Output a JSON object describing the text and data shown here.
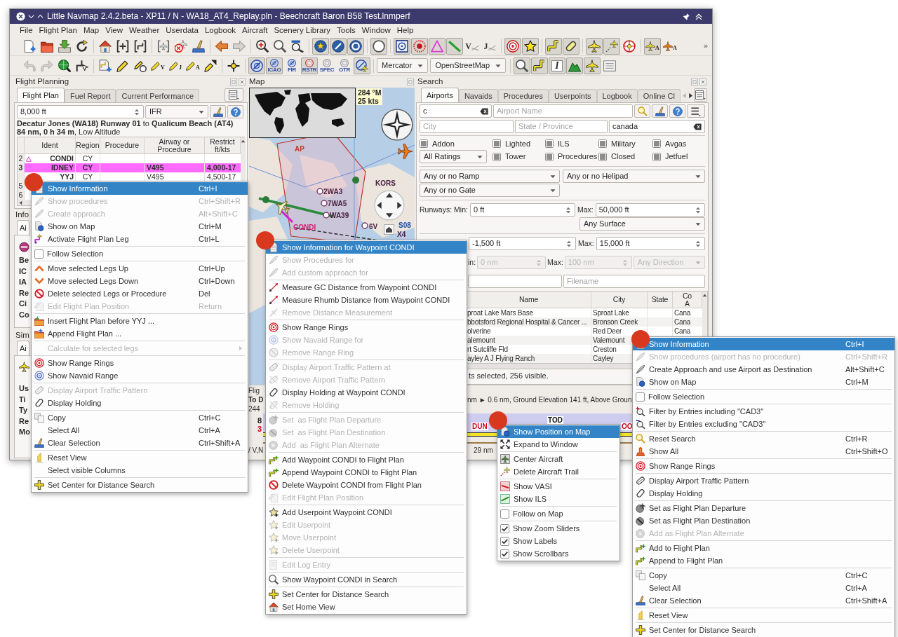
{
  "window": {
    "title": "Little Navmap 2.4.2.beta - XP11 / N - WA18_AT4_Replay.pln - Beechcraft Baron B58 Test.lnmperf"
  },
  "menu_bar": [
    "File",
    "Flight Plan",
    "Map",
    "View",
    "Weather",
    "Userdata",
    "Logbook",
    "Aircraft",
    "Scenery Library",
    "Tools",
    "Window",
    "Help"
  ],
  "toolbars": [
    [
      {
        "kind": "button",
        "pressed": false
      },
      {
        "kind": "button",
        "pressed": false
      },
      {
        "kind": "button",
        "pressed": false
      },
      {
        "kind": "button",
        "pressed": false
      },
      {
        "kind": "separator"
      },
      {
        "kind": "button",
        "pressed": false
      },
      {
        "kind": "button",
        "pressed": false
      },
      {
        "kind": "button",
        "pressed": false
      },
      {
        "kind": "separator"
      },
      {
        "kind": "button",
        "pressed": false
      },
      {
        "kind": "button",
        "pressed": false
      },
      {
        "kind": "button",
        "pressed": false
      },
      {
        "kind": "separator"
      },
      {
        "kind": "button",
        "pressed": false
      },
      {
        "kind": "button",
        "pressed": false
      },
      {
        "kind": "separator"
      },
      {
        "kind": "button",
        "pressed": false
      },
      {
        "kind": "button",
        "pressed": false
      },
      {
        "kind": "button",
        "pressed": false
      },
      {
        "kind": "separator"
      },
      {
        "kind": "button",
        "pressed": true
      },
      {
        "kind": "button",
        "pressed": true
      },
      {
        "kind": "button",
        "pressed": true
      },
      {
        "kind": "separator"
      },
      {
        "kind": "button",
        "pressed": true
      },
      {
        "kind": "separator"
      },
      {
        "kind": "button",
        "pressed": true
      },
      {
        "kind": "button",
        "pressed": true
      },
      {
        "kind": "button",
        "pressed": true
      },
      {
        "kind": "button",
        "pressed": true
      },
      {
        "kind": "button",
        "pressed": false,
        "label": "V"
      },
      {
        "kind": "button",
        "pressed": false,
        "label": "J"
      },
      {
        "kind": "separator"
      },
      {
        "kind": "button",
        "pressed": true
      },
      {
        "kind": "button",
        "pressed": true
      },
      {
        "kind": "separator"
      },
      {
        "kind": "button",
        "pressed": true
      },
      {
        "kind": "button",
        "pressed": true
      },
      {
        "kind": "separator"
      },
      {
        "kind": "button",
        "pressed": true
      },
      {
        "kind": "button",
        "pressed": true
      },
      {
        "kind": "button",
        "pressed": false
      },
      {
        "kind": "separator"
      },
      {
        "kind": "button",
        "pressed": true,
        "label": "A"
      },
      {
        "kind": "button",
        "pressed": false,
        "label": "A"
      },
      {
        "kind": "overflow",
        "label": "»"
      }
    ],
    [
      {
        "kind": "button",
        "pressed": false
      },
      {
        "kind": "button",
        "pressed": false
      },
      {
        "kind": "button",
        "pressed": false
      },
      {
        "kind": "button",
        "pressed": false
      },
      {
        "kind": "separator"
      },
      {
        "kind": "button",
        "pressed": false
      },
      {
        "kind": "button",
        "pressed": false
      },
      {
        "kind": "button",
        "pressed": false
      },
      {
        "kind": "button",
        "pressed": false,
        "label": "V"
      },
      {
        "kind": "button",
        "pressed": false,
        "label": "J"
      },
      {
        "kind": "button",
        "pressed": false,
        "label": "A"
      },
      {
        "kind": "button",
        "pressed": false
      },
      {
        "kind": "separator"
      },
      {
        "kind": "button",
        "pressed": false
      },
      {
        "kind": "separator"
      },
      {
        "kind": "button",
        "pressed": true
      },
      {
        "kind": "button",
        "pressed": true,
        "label": "ICAO"
      },
      {
        "kind": "button",
        "pressed": false,
        "label": "FIR"
      },
      {
        "kind": "button",
        "pressed": true,
        "label": "RSTR"
      },
      {
        "kind": "button",
        "pressed": false,
        "label": "SPEC"
      },
      {
        "kind": "button",
        "pressed": false,
        "label": "OTR"
      },
      {
        "kind": "button",
        "pressed": true
      },
      {
        "kind": "separator"
      },
      {
        "kind": "combo",
        "value": "Mercator"
      },
      {
        "kind": "combo",
        "value": "OpenStreetMap"
      },
      {
        "kind": "separator"
      },
      {
        "kind": "button",
        "pressed": true
      },
      {
        "kind": "button",
        "pressed": true
      },
      {
        "kind": "button",
        "pressed": true,
        "label": "I"
      },
      {
        "kind": "button",
        "pressed": true
      },
      {
        "kind": "button",
        "pressed": true
      },
      {
        "kind": "button",
        "pressed": false
      }
    ]
  ],
  "flight_planning": {
    "title": "Flight Planning",
    "tabs": [
      {
        "label": "Flight Plan",
        "selected": true
      },
      {
        "label": "Fuel Report",
        "selected": false
      },
      {
        "label": "Current Performance",
        "selected": false
      }
    ],
    "altitude": "8,000 ft",
    "flight_rules": "IFR",
    "route_summary": "**Decatur Jones (WA18) Runway 01** to **Qualicum Beach (AT4)**",
    "route_details": "**84 nm, 0 h 34 m**, Low Altitude",
    "table": {
      "columns": [
        "Ident",
        "Region",
        "Procedure",
        "Airway or Procedure",
        "Restrict ft/kts"
      ],
      "rows": [
        {
          "number": "2",
          "kind": "waypoint",
          "ident": "CONDI",
          "region": "CY",
          "active": false
        },
        {
          "number": "3",
          "kind": "plain",
          "ident": "IDNEY",
          "region": "CY",
          "airway": "V495",
          "restriction": "4,000-17",
          "active": true
        },
        {
          "kind": "plain",
          "ident": "YYJ",
          "region": "CY",
          "airway": "V495",
          "restriction": "4,500-17",
          "active": false
        },
        {
          "number": "5",
          "kind": "plain",
          "active": false
        },
        {
          "number": "6",
          "kind": "plain",
          "active": false
        }
      ]
    }
  },
  "info_panel": {
    "title": "Info",
    "tabs": [
      {
        "label": "Ai",
        "selected": true
      }
    ],
    "labels": [
      "Be",
      "IC",
      "IA",
      "Re",
      "Ci",
      "Co"
    ]
  },
  "simulator_panel": {
    "title": "Sim",
    "tabs": [
      {
        "label": "Ai",
        "selected": true
      }
    ],
    "labels": [
      "Us",
      "Ti",
      "Ty",
      "Re",
      "Mo"
    ]
  },
  "map": {
    "title": "Map",
    "wind": {
      "direction": "284 °M",
      "speed": "25 kts"
    },
    "labels": [
      {
        "text": "AP",
        "kind": "airspace"
      },
      {
        "text": "2WA3",
        "kind": "airport"
      },
      {
        "text": "7WA5",
        "kind": "airport"
      },
      {
        "text": "WA39",
        "kind": "airport"
      },
      {
        "text": "KORS",
        "kind": "airport"
      },
      {
        "text": "CONDI",
        "kind": "waypoint"
      },
      {
        "text": "6V",
        "kind": "airport"
      },
      {
        "text": "S08",
        "kind": "navaid"
      },
      {
        "text": "X4",
        "kind": "airport"
      }
    ]
  },
  "search": {
    "title": "Search",
    "tabs": [
      {
        "label": "Airports",
        "selected": true
      },
      {
        "label": "Navaids",
        "selected": false
      },
      {
        "label": "Procedures",
        "selected": false
      },
      {
        "label": "Userpoints",
        "selected": false
      },
      {
        "label": "Logbook",
        "selected": false
      },
      {
        "label": "Online Cl",
        "selected": false
      }
    ],
    "ident": "c",
    "name_placeholder": "Airport Name",
    "city_placeholder": "City",
    "state_placeholder": "State / Province",
    "country": "canada",
    "checkboxes": [
      {
        "label": "Addon",
        "indeterminate": true
      },
      {
        "label": "Lighted",
        "indeterminate": true
      },
      {
        "label": "ILS",
        "indeterminate": true
      },
      {
        "label": "Military",
        "indeterminate": true
      },
      {
        "label": "Avgas",
        "indeterminate": true
      },
      {
        "label": "Tower",
        "indeterminate": true
      },
      {
        "label": "Procedures",
        "indeterminate": true
      },
      {
        "label": "Closed",
        "indeterminate": true
      },
      {
        "label": "Jetfuel",
        "indeterminate": true
      }
    ],
    "rating": "All Ratings",
    "ramp": "Any or no Ramp",
    "helipad": "Any or no Helipad",
    "gate": "Any or no Gate",
    "runways": {
      "label": "Runways:",
      "min_label": "Min:",
      "min": "0 ft",
      "max_label": "Max:",
      "max": "50,000 ft",
      "surface": "Any Surface"
    },
    "altitude": {
      "min": "-1,500 ft",
      "max_label": "Max:",
      "max": "15,000 ft"
    },
    "distance": {
      "min_label": "in:",
      "min": "0 nm",
      "max_label": "Max:",
      "max": "100 nm",
      "direction": "Any Direction",
      "disabled": true
    },
    "filename_placeholder": "Filename",
    "table": {
      "columns": [
        "Name",
        "City",
        "State",
        "Co A"
      ],
      "rows": [
        {
          "name": "proat Lake Mars Base",
          "city": "Sproat Lake",
          "column_4": "Cana"
        },
        {
          "name": "bbotsford Regional Hospital & Cancer ...",
          "city": "Bronson Creek",
          "column_4": "Cana"
        },
        {
          "name": "olverine",
          "city": "Red Deer",
          "column_4": "Cana"
        },
        {
          "name": "alemount",
          "city": "Valemount"
        },
        {
          "name": "rt Sutcliffe Fld",
          "city": "Creston"
        },
        {
          "name": "ayley A J Flying Ranch",
          "city": "Cayley"
        }
      ]
    },
    "status": "ts selected, 256 visible."
  },
  "elevation_profile": {
    "info_lines": [
      "Flig",
      "**To D**",
      "244"
    ],
    "info_tail": "nm ► 0.6 nm, Ground Elevation 141 ft, Above Groun",
    "axis_labels": [
      {
        "text": "8",
        "color": "#222222"
      },
      {
        "text": "3",
        "color": "#d0021b"
      }
    ],
    "markers": [
      {
        "text": "DUN",
        "color": "#d0021b"
      },
      {
        "text": "TOD",
        "color": "#111111"
      },
      {
        "text": "OO",
        "color": "#d0021b"
      }
    ],
    "distance": "29 nm",
    "footer": "/ V,N"
  },
  "context_menus": [
    {
      "items": [
        {
          "kind": "item",
          "label": "Show Information",
          "shortcut": "Ctrl+I",
          "selected": true,
          "disabled": false
        },
        {
          "kind": "item",
          "label": "Show procedures",
          "shortcut": "Ctrl+Shift+R",
          "selected": false,
          "disabled": true
        },
        {
          "kind": "item",
          "label": "Create approach",
          "shortcut": "Alt+Shift+C",
          "selected": false,
          "disabled": true
        },
        {
          "kind": "item",
          "label": "Show on Map",
          "shortcut": "Ctrl+M",
          "selected": false,
          "disabled": false
        },
        {
          "kind": "item",
          "label": "Activate Flight Plan Leg",
          "shortcut": "Ctrl+L",
          "selected": false,
          "disabled": false
        },
        {
          "kind": "separator"
        },
        {
          "kind": "checkbox",
          "label": "Follow Selection",
          "checked": false,
          "selected": false,
          "disabled": false
        },
        {
          "kind": "separator"
        },
        {
          "kind": "item",
          "label": "Move selected Legs Up",
          "shortcut": "Ctrl+Up",
          "selected": false,
          "disabled": false
        },
        {
          "kind": "item",
          "label": "Move selected Legs Down",
          "shortcut": "Ctrl+Down",
          "selected": false,
          "disabled": false
        },
        {
          "kind": "item",
          "label": "Delete selected Legs or Procedure",
          "shortcut": "Del",
          "selected": false,
          "disabled": false
        },
        {
          "kind": "item",
          "label": "Edit Flight Plan Position",
          "shortcut": "Return",
          "selected": false,
          "disabled": true
        },
        {
          "kind": "separator"
        },
        {
          "kind": "item",
          "label": "Insert Flight Plan before YYJ ...",
          "selected": false,
          "disabled": false
        },
        {
          "kind": "item",
          "label": "Append Flight Plan ...",
          "selected": false,
          "disabled": false
        },
        {
          "kind": "separator"
        },
        {
          "kind": "submenu",
          "label": "Calculate for selected legs",
          "selected": false,
          "disabled": true
        },
        {
          "kind": "separator"
        },
        {
          "kind": "item",
          "label": "Show Range Rings",
          "selected": false,
          "disabled": false
        },
        {
          "kind": "item",
          "label": "Show Navaid Range",
          "selected": false,
          "disabled": false
        },
        {
          "kind": "separator"
        },
        {
          "kind": "item",
          "label": "Display Airport Traffic Pattern",
          "selected": false,
          "disabled": true
        },
        {
          "kind": "item",
          "label": "Display Holding",
          "selected": false,
          "disabled": false
        },
        {
          "kind": "separator"
        },
        {
          "kind": "item",
          "label": "Copy",
          "shortcut": "Ctrl+C",
          "selected": false,
          "disabled": false
        },
        {
          "kind": "item",
          "label": "Select All",
          "shortcut": "Ctrl+A",
          "selected": false,
          "disabled": false
        },
        {
          "kind": "item",
          "label": "Clear Selection",
          "shortcut": "Ctrl+Shift+A",
          "selected": false,
          "disabled": false
        },
        {
          "kind": "separator"
        },
        {
          "kind": "item",
          "label": "Reset View",
          "selected": false,
          "disabled": false
        },
        {
          "kind": "item",
          "label": "Select visible Columns",
          "selected": false,
          "disabled": false
        },
        {
          "kind": "separator"
        },
        {
          "kind": "item",
          "label": "Set Center for Distance Search",
          "selected": false,
          "disabled": false
        }
      ]
    },
    {
      "items": [
        {
          "kind": "item",
          "label": "Show Information for Waypoint CONDI",
          "selected": true,
          "disabled": false
        },
        {
          "kind": "item",
          "label": "Show Procedures for",
          "selected": false,
          "disabled": true
        },
        {
          "kind": "item",
          "label": "Add custom approach for",
          "selected": false,
          "disabled": true
        },
        {
          "kind": "separator"
        },
        {
          "kind": "item",
          "label": "Measure GC Distance from Waypoint CONDI",
          "selected": false,
          "disabled": false
        },
        {
          "kind": "item",
          "label": "Measure Rhumb Distance from Waypoint CONDI",
          "selected": false,
          "disabled": false
        },
        {
          "kind": "item",
          "label": "Remove Distance Measurement",
          "selected": false,
          "disabled": true
        },
        {
          "kind": "separator"
        },
        {
          "kind": "item",
          "label": "Show Range Rings",
          "selected": false,
          "disabled": false
        },
        {
          "kind": "item",
          "label": "Show Navaid Range for",
          "selected": false,
          "disabled": true
        },
        {
          "kind": "item",
          "label": "Remove Range Ring",
          "selected": false,
          "disabled": true
        },
        {
          "kind": "separator"
        },
        {
          "kind": "item",
          "label": "Display Airport Traffic Pattern at",
          "selected": false,
          "disabled": true
        },
        {
          "kind": "item",
          "label": "Remove Airport Traffic Pattern",
          "selected": false,
          "disabled": true
        },
        {
          "kind": "item",
          "label": "Display Holding at Waypoint CONDI",
          "selected": false,
          "disabled": false
        },
        {
          "kind": "item",
          "label": "Remove Holding",
          "selected": false,
          "disabled": true
        },
        {
          "kind": "separator"
        },
        {
          "kind": "item",
          "label": "Set  as Flight Plan Departure",
          "selected": false,
          "disabled": true
        },
        {
          "kind": "item",
          "label": "Set  as Flight Plan Destination",
          "selected": false,
          "disabled": true
        },
        {
          "kind": "item",
          "label": "Add  as Flight Plan Alternate",
          "selected": false,
          "disabled": true
        },
        {
          "kind": "separator"
        },
        {
          "kind": "item",
          "label": "Add Waypoint CONDI to Flight Plan",
          "selected": false,
          "disabled": false
        },
        {
          "kind": "item",
          "label": "Append Waypoint CONDI to Flight Plan",
          "selected": false,
          "disabled": false
        },
        {
          "kind": "item",
          "label": "Delete Waypoint CONDI from Flight Plan",
          "selected": false,
          "disabled": false
        },
        {
          "kind": "item",
          "label": "Edit Flight Plan Position",
          "selected": false,
          "disabled": true
        },
        {
          "kind": "separator"
        },
        {
          "kind": "item",
          "label": "Add Userpoint Waypoint CONDI",
          "selected": false,
          "disabled": false
        },
        {
          "kind": "item",
          "label": "Edit Userpoint",
          "selected": false,
          "disabled": true
        },
        {
          "kind": "item",
          "label": "Move Userpoint",
          "selected": false,
          "disabled": true
        },
        {
          "kind": "item",
          "label": "Delete Userpoint",
          "selected": false,
          "disabled": true
        },
        {
          "kind": "separator"
        },
        {
          "kind": "item",
          "label": "Edit Log Entry",
          "selected": false,
          "disabled": true
        },
        {
          "kind": "separator"
        },
        {
          "kind": "item",
          "label": "Show Waypoint CONDI in Search",
          "selected": false,
          "disabled": false
        },
        {
          "kind": "separator"
        },
        {
          "kind": "item",
          "label": "Set Center for Distance Search",
          "selected": false,
          "disabled": false
        },
        {
          "kind": "item",
          "label": "Set Home View",
          "selected": false,
          "disabled": false
        }
      ]
    },
    {
      "items": [
        {
          "kind": "item",
          "label": "Show Position on Map",
          "selected": true,
          "disabled": false
        },
        {
          "kind": "item",
          "label": "Expand to Window",
          "selected": false,
          "disabled": false
        },
        {
          "kind": "separator"
        },
        {
          "kind": "item",
          "label": "Center Aircraft",
          "selected": false,
          "disabled": false
        },
        {
          "kind": "item",
          "label": "Delete Aircraft Trail",
          "selected": false,
          "disabled": false
        },
        {
          "kind": "separator"
        },
        {
          "kind": "item",
          "label": "Show VASI",
          "selected": false,
          "disabled": false
        },
        {
          "kind": "item",
          "label": "Show ILS",
          "selected": false,
          "disabled": false
        },
        {
          "kind": "separator"
        },
        {
          "kind": "checkbox",
          "label": "Follow on Map",
          "checked": false,
          "selected": false,
          "disabled": false
        },
        {
          "kind": "separator"
        },
        {
          "kind": "checkbox",
          "label": "Show Zoom Sliders",
          "checked": true,
          "selected": false,
          "disabled": false
        },
        {
          "kind": "checkbox",
          "label": "Show Labels",
          "checked": true,
          "selected": false,
          "disabled": false
        },
        {
          "kind": "checkbox",
          "label": "Show Scrollbars",
          "checked": true,
          "selected": false,
          "disabled": false
        }
      ]
    },
    {
      "items": [
        {
          "kind": "item",
          "label": "Show Information",
          "shortcut": "Ctrl+I",
          "selected": true,
          "disabled": false
        },
        {
          "kind": "item",
          "label": "Show procedures (airport has no procedure)",
          "shortcut": "Ctrl+Shift+R",
          "selected": false,
          "disabled": true
        },
        {
          "kind": "item",
          "label": "Create Approach and use Airport as Destination",
          "shortcut": "Alt+Shift+C",
          "selected": false,
          "disabled": false
        },
        {
          "kind": "item",
          "label": "Show on Map",
          "shortcut": "Ctrl+M",
          "selected": false,
          "disabled": false
        },
        {
          "kind": "separator"
        },
        {
          "kind": "checkbox",
          "label": "Follow Selection",
          "checked": false,
          "selected": false,
          "disabled": false
        },
        {
          "kind": "separator"
        },
        {
          "kind": "item",
          "label": "Filter by Entries including \"CAD3\"",
          "selected": false,
          "disabled": false
        },
        {
          "kind": "item",
          "label": "Filter by Entries excluding \"CAD3\"",
          "selected": false,
          "disabled": false
        },
        {
          "kind": "separator"
        },
        {
          "kind": "item",
          "label": "Reset Search",
          "shortcut": "Ctrl+R",
          "selected": false,
          "disabled": false
        },
        {
          "kind": "item",
          "label": "Show All",
          "shortcut": "Ctrl+Shift+O",
          "selected": false,
          "disabled": false
        },
        {
          "kind": "separator"
        },
        {
          "kind": "item",
          "label": "Show Range Rings",
          "selected": false,
          "disabled": false
        },
        {
          "kind": "separator"
        },
        {
          "kind": "item",
          "label": "Display Airport Traffic Pattern",
          "selected": false,
          "disabled": false
        },
        {
          "kind": "item",
          "label": "Display Holding",
          "selected": false,
          "disabled": false
        },
        {
          "kind": "separator"
        },
        {
          "kind": "item",
          "label": "Set as Flight Plan Departure",
          "selected": false,
          "disabled": false
        },
        {
          "kind": "item",
          "label": "Set as Flight Plan Destination",
          "selected": false,
          "disabled": false
        },
        {
          "kind": "item",
          "label": "Add as Flight Plan Alternate",
          "selected": false,
          "disabled": true
        },
        {
          "kind": "separator"
        },
        {
          "kind": "item",
          "label": "Add to Flight Plan",
          "selected": false,
          "disabled": false
        },
        {
          "kind": "item",
          "label": "Append to Flight Plan",
          "selected": false,
          "disabled": false
        },
        {
          "kind": "separator"
        },
        {
          "kind": "item",
          "label": "Copy",
          "shortcut": "Ctrl+C",
          "selected": false,
          "disabled": false
        },
        {
          "kind": "item",
          "label": "Select All",
          "shortcut": "Ctrl+A",
          "selected": false,
          "disabled": false
        },
        {
          "kind": "item",
          "label": "Clear Selection",
          "shortcut": "Ctrl+Shift+A",
          "selected": false,
          "disabled": false
        },
        {
          "kind": "separator"
        },
        {
          "kind": "item",
          "label": "Reset View",
          "selected": false,
          "disabled": false
        },
        {
          "kind": "separator"
        },
        {
          "kind": "item",
          "label": "Set Center for Distance Search",
          "selected": false,
          "disabled": false
        }
      ]
    }
  ]
}
